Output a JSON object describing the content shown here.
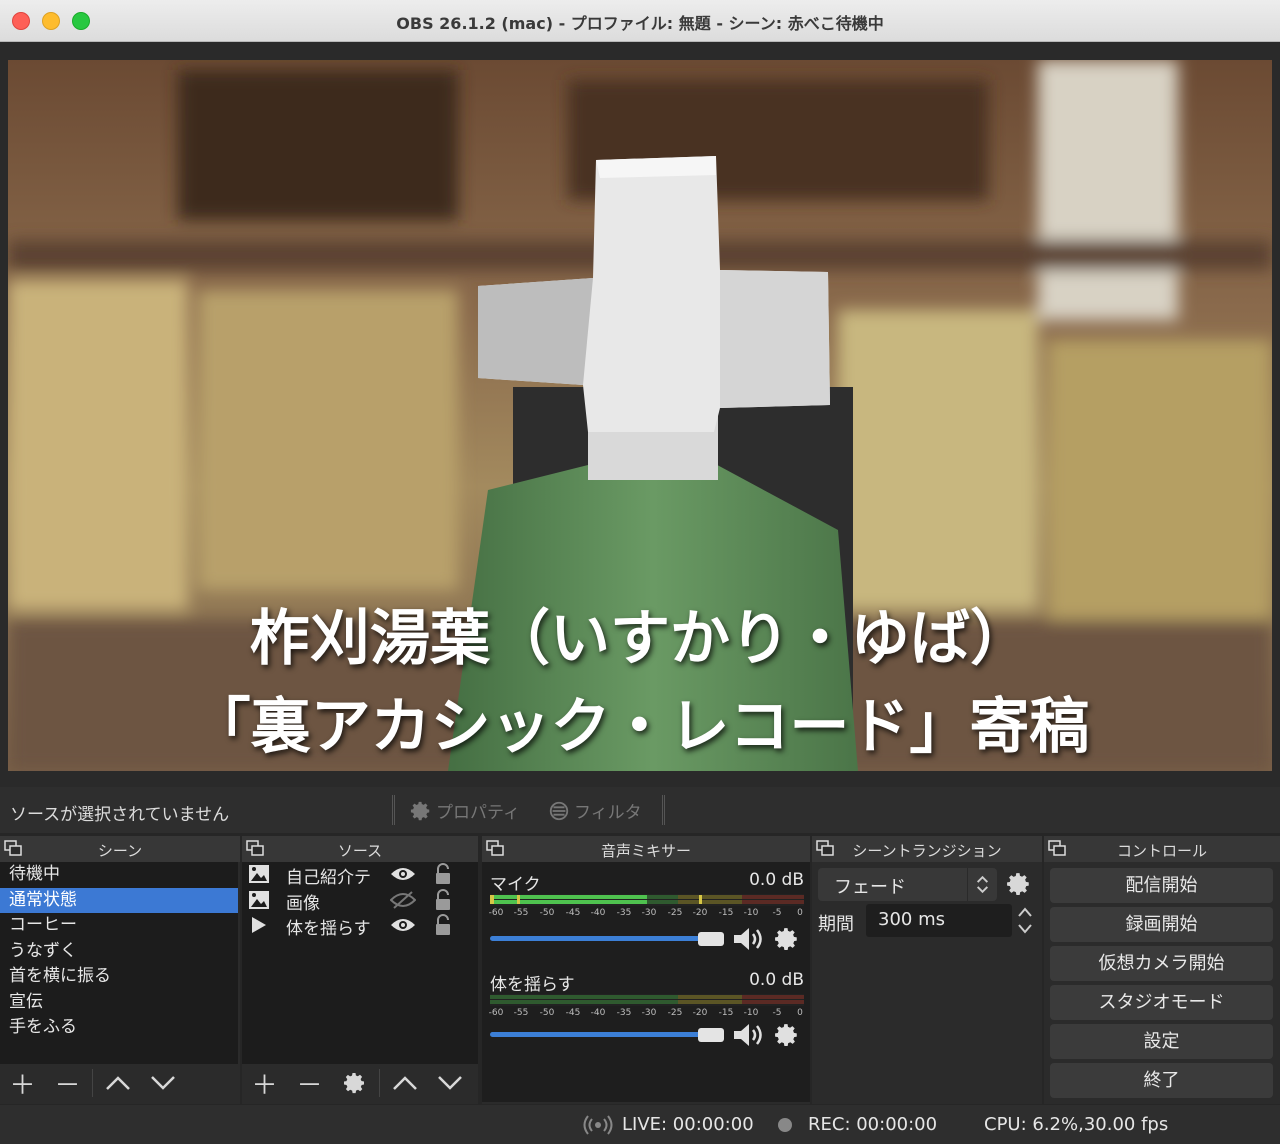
{
  "window": {
    "title": "OBS 26.1.2 (mac) - プロファイル: 無題 - シーン: 赤べこ待機中"
  },
  "preview": {
    "caption_line1": "柞刈湯葉（いすかり・ゆば）",
    "caption_line2": "「裏アカシック・レコード」寄稿"
  },
  "source_toolbar": {
    "no_source": "ソースが選択されていません",
    "properties": "プロパティ",
    "filters": "フィルタ"
  },
  "scenes": {
    "title": "シーン",
    "items": [
      "待機中",
      "通常状態",
      "コーヒー",
      "うなずく",
      "首を横に振る",
      "宣伝",
      "手をふる"
    ],
    "selected_index": 1
  },
  "sources": {
    "title": "ソース",
    "items": [
      {
        "name": "自己紹介テ",
        "icon": "image-icon",
        "visible": true
      },
      {
        "name": "画像",
        "icon": "image-icon",
        "visible": false
      },
      {
        "name": "体を揺らす",
        "icon": "play-icon",
        "visible": true
      }
    ]
  },
  "mixer": {
    "title": "音声ミキサー",
    "channels": [
      {
        "name": "マイク",
        "db": "0.0 dB",
        "level": -25,
        "volume": 1.0
      },
      {
        "name": "体を揺らす",
        "db": "0.0 dB",
        "level": -60,
        "volume": 1.0
      }
    ],
    "scale": [
      "-60",
      "-55",
      "-50",
      "-45",
      "-40",
      "-35",
      "-30",
      "-25",
      "-20",
      "-15",
      "-10",
      "-5",
      "0"
    ]
  },
  "transitions": {
    "title": "シーントランジション",
    "type": "フェード",
    "duration_label": "期間",
    "duration": "300 ms"
  },
  "controls": {
    "title": "コントロール",
    "buttons": [
      "配信開始",
      "録画開始",
      "仮想カメラ開始",
      "スタジオモード",
      "設定",
      "終了"
    ]
  },
  "status": {
    "live": "LIVE: 00:00:00",
    "rec": "REC: 00:00:00",
    "cpu": "CPU: 6.2%,30.00 fps"
  },
  "colors": {
    "selection": "#3c79d4",
    "meter_green": "#4fc24f",
    "meter_yellow": "#d6c646",
    "meter_red": "#d04a3a"
  }
}
